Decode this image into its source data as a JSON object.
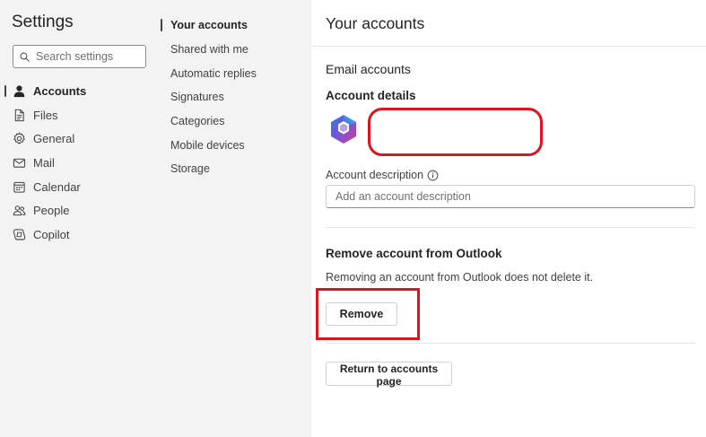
{
  "settings": {
    "title": "Settings",
    "search_placeholder": "Search settings"
  },
  "nav": {
    "items": [
      {
        "label": "Accounts",
        "icon": "person-icon",
        "active": true
      },
      {
        "label": "Files",
        "icon": "document-icon"
      },
      {
        "label": "General",
        "icon": "gear-icon"
      },
      {
        "label": "Mail",
        "icon": "mail-icon"
      },
      {
        "label": "Calendar",
        "icon": "calendar-icon"
      },
      {
        "label": "People",
        "icon": "people-icon"
      },
      {
        "label": "Copilot",
        "icon": "copilot-icon"
      }
    ]
  },
  "subnav": {
    "items": [
      {
        "label": "Your accounts",
        "active": true
      },
      {
        "label": "Shared with me"
      },
      {
        "label": "Automatic replies"
      },
      {
        "label": "Signatures"
      },
      {
        "label": "Categories"
      },
      {
        "label": "Mobile devices"
      },
      {
        "label": "Storage"
      }
    ]
  },
  "main": {
    "title": "Your accounts",
    "email_accounts_heading": "Email accounts",
    "account_details_heading": "Account details",
    "account_logo_icon": "microsoft-365-icon",
    "account_description_label": "Account description",
    "account_description_placeholder": "Add an account description",
    "account_description_value": "",
    "remove_heading": "Remove account from Outlook",
    "remove_note": "Removing an account from Outlook does not delete it.",
    "remove_button": "Remove",
    "return_button": "Return to accounts page"
  },
  "annotations": {
    "highlight_color": "#e0121f"
  }
}
